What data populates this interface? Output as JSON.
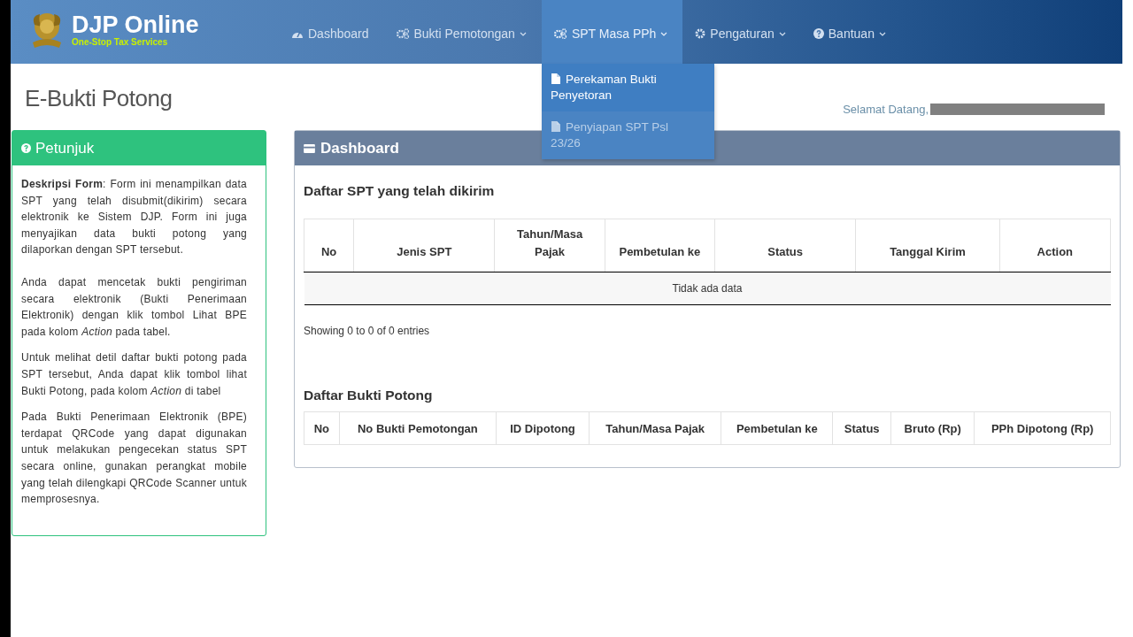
{
  "brand": {
    "title": "DJP Online",
    "tagline": "One-Stop Tax Services"
  },
  "nav": [
    {
      "label": "Dashboard",
      "has_menu": false,
      "selected": false
    },
    {
      "label": "Bukti Pemotongan",
      "has_menu": true,
      "selected": false
    },
    {
      "label": "SPT Masa PPh",
      "has_menu": true,
      "selected": true,
      "menu": [
        {
          "label": "Perekaman Bukti Penyetoran",
          "selected": true
        },
        {
          "label": "Penyiapan SPT Psl 23/26",
          "selected": false
        }
      ]
    },
    {
      "label": "Pengaturan",
      "has_menu": true,
      "selected": false
    },
    {
      "label": "Bantuan",
      "has_menu": true,
      "selected": false
    }
  ],
  "page_title": "E-Bukti Potong",
  "welcome": "Selamat Datang,",
  "guide": {
    "title": "Petunjuk",
    "paragraphs": [
      "**Deskripsi Form**: Form ini menampilkan data SPT yang telah disubmit(dikirim) secara elektronik ke Sistem DJP. Form ini juga menyajikan data bukti potong yang dilaporkan dengan SPT tersebut.",
      "Anda dapat mencetak bukti pengiriman secara elektronik (Bukti Penerimaan Elektronik) dengan klik tombol Lihat BPE pada kolom *Action* pada tabel.",
      "Untuk melihat detil daftar bukti potong pada SPT tersebut, Anda dapat klik tombol lihat Bukti Potong, pada kolom *Action* di tabel",
      "Pada Bukti Penerimaan Elektronik (BPE) terdapat QRCode yang dapat digunakan untuk melakukan pengecekan status SPT secara online, gunakan perangkat mobile yang telah dilengkapi QRCode Scanner untuk memprosesnya."
    ]
  },
  "dashboard": {
    "title": "Dashboard",
    "spt_table": {
      "title": "Daftar SPT yang telah dikirim",
      "columns": [
        "No",
        "Jenis SPT",
        "Tahun/Masa Pajak",
        "Pembetulan ke",
        "Status",
        "Tanggal Kirim",
        "Action"
      ],
      "empty_text": "Tidak ada data",
      "info": "Showing 0 to 0 of 0 entries"
    },
    "bukti_table": {
      "title": "Daftar Bukti Potong",
      "columns": [
        "No",
        "No Bukti Pemotongan",
        "ID Dipotong",
        "Tahun/Masa Pajak",
        "Pembetulan ke",
        "Status",
        "Bruto (Rp)",
        "PPh Dipotong (Rp)"
      ]
    }
  }
}
